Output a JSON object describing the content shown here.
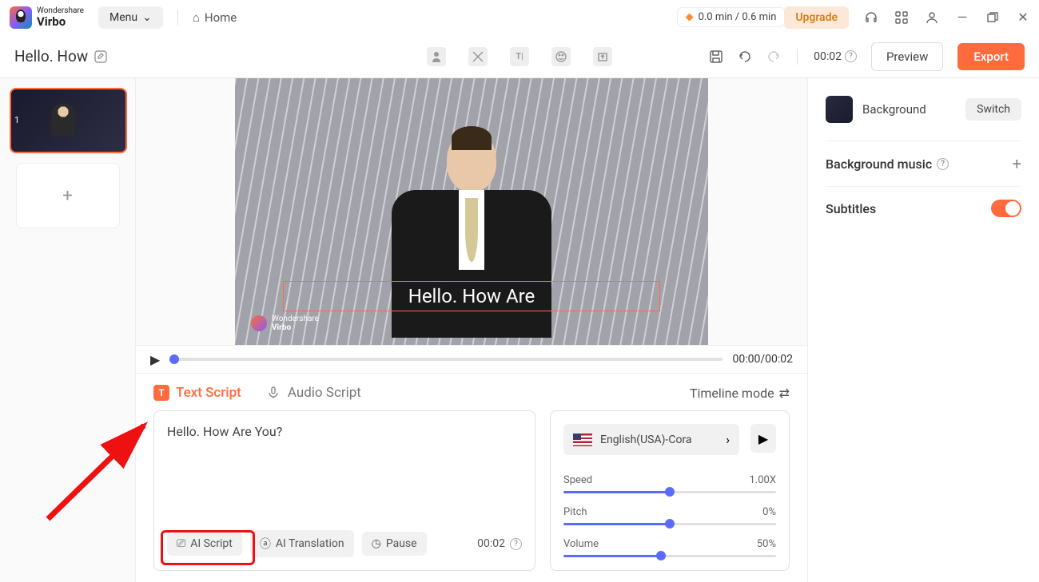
{
  "titlebar": {
    "brand_top": "Wondershare",
    "brand": "Virbo",
    "menu": "Menu",
    "home": "Home",
    "credits": "0.0 min / 0.6 min",
    "upgrade": "Upgrade"
  },
  "toolbar": {
    "project_title": "Hello. How",
    "time": "00:02",
    "preview": "Preview",
    "export": "Export"
  },
  "sidebar": {
    "thumb_index": "1"
  },
  "preview": {
    "subtitle": "Hello. How Are",
    "watermark_top": "Wondershare",
    "watermark_brand": "Virbo"
  },
  "controls": {
    "time": "00:00/00:02"
  },
  "tabs": {
    "text_script": "Text Script",
    "audio_script": "Audio Script",
    "timeline_mode": "Timeline mode"
  },
  "script": {
    "content": "Hello. How Are You?",
    "ai_script": "AI Script",
    "ai_translation": "AI Translation",
    "pause": "Pause",
    "time": "00:02"
  },
  "voice": {
    "name": "English(USA)-Cora",
    "speed_label": "Speed",
    "speed_value": "1.00X",
    "pitch_label": "Pitch",
    "pitch_value": "0%",
    "volume_label": "Volume",
    "volume_value": "50%"
  },
  "right_panel": {
    "background": "Background",
    "switch": "Switch",
    "bg_music": "Background music",
    "subtitles": "Subtitles"
  }
}
